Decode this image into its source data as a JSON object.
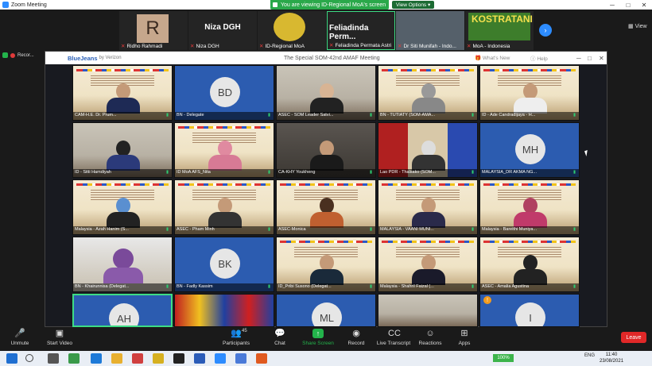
{
  "window": {
    "title": "Zoom Meeting"
  },
  "banner": {
    "text": "You are viewing ID-Regional MoA's screen",
    "view_options": "View Options ▾"
  },
  "strip": {
    "thumbs": [
      {
        "name": "Ridho Rahmadi",
        "initial": "R"
      },
      {
        "name": "Niza DGH",
        "big": "Niza DGH"
      },
      {
        "name": "ID-Regional MoA"
      },
      {
        "name": "Feliadinda Permata Astri",
        "big": "Feliadinda Perm..."
      },
      {
        "name": "Dr Siti Munifah - Indo..."
      },
      {
        "name": "MoA - Indonesia",
        "logo_text": "KOSTRATANI"
      }
    ],
    "view_label": "View"
  },
  "recording": {
    "label": "Recor..."
  },
  "bluejeans": {
    "brand": "BlueJeans",
    "by": "by Verizon",
    "meeting_title": "The Special SOM-42nd AMAF Meeting",
    "whats_new": "What's New",
    "help": "Help"
  },
  "tiles": [
    "CAM-H.E. Dr. Prum...",
    "BN - Delegate",
    "ASEC - SOM Leader Satvi...",
    "BN - TUTIATY (SOM-AMA...",
    "ID - Ade Candradijaya - H...",
    "ID - Sitti Hamdiyah",
    "ID MoA AFS_Nita",
    "CA-KHY Youkheng",
    "Lao PDR - Thalsako (SOM...",
    "MALAYSIA_DR AKMA NG...",
    "Malaysia - Azah Hanim (S...",
    "ASEC - Pham Minh",
    "ASEC-Monica",
    "MALAYSIA - VAANI MUNI...",
    "Malaysia - Bareithi Muniya...",
    "BN - Khairunnisa (Delegat...",
    "BN - Fadly Kassim",
    "ID_Pribi Susono (Delegat...",
    "Malaysia - Shahril Faizal (...",
    "ASEC - Amalia Agustina",
    "",
    "",
    "",
    "",
    ""
  ],
  "initials": {
    "bd": "BD",
    "mh": "MH",
    "bk": "BK",
    "ah": "AH",
    "ml": "ML",
    "i": "I"
  },
  "toolbar": {
    "unmute": "Unmute",
    "start_video": "Start Video",
    "participants": "Participants",
    "participants_count": "45",
    "chat": "Chat",
    "share": "Share Screen",
    "record": "Record",
    "transcript": "Live Transcript",
    "reactions": "Reactions",
    "apps": "Apps",
    "leave": "Leave"
  },
  "taskbar": {
    "battery": "100%",
    "lang": "ENG",
    "time": "11:40",
    "date": "23/08/2021"
  }
}
